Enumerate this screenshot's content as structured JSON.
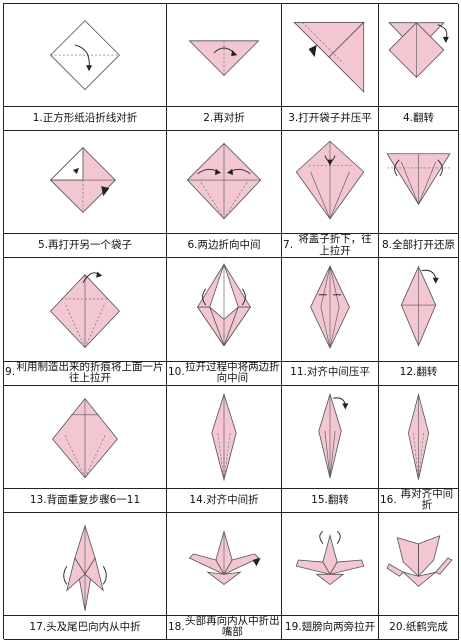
{
  "steps": [
    {
      "num": "1",
      "text": "正方形纸沿折线对折"
    },
    {
      "num": "2",
      "text": "再对折"
    },
    {
      "num": "3",
      "text": "打开袋子并压平"
    },
    {
      "num": "4",
      "text": "翻转"
    },
    {
      "num": "5",
      "text": "再打开另一个袋子"
    },
    {
      "num": "6",
      "text": "两边折向中间"
    },
    {
      "num": "7",
      "text": "将盖子折下，往上拉开"
    },
    {
      "num": "8",
      "text": "全部打开还原"
    },
    {
      "num": "9",
      "text": "利用制造出来的折痕将上面一片往上拉开"
    },
    {
      "num": "10",
      "text": "拉开过程中将两边折向中间"
    },
    {
      "num": "11",
      "text": "对齐中间压平"
    },
    {
      "num": "12",
      "text": "翻转"
    },
    {
      "num": "13",
      "text": "背面重复步骤6一11"
    },
    {
      "num": "14",
      "text": "对齐中间折"
    },
    {
      "num": "15",
      "text": "翻转"
    },
    {
      "num": "16",
      "text": "再对齐中间折"
    },
    {
      "num": "17",
      "text": "头及尾巴向内从中折"
    },
    {
      "num": "18",
      "text": "头部再向内从中折出嘴部"
    },
    {
      "num": "19",
      "text": "翅膀向两旁拉开"
    },
    {
      "num": "20",
      "text": "纸鹤完成"
    }
  ],
  "colors": {
    "paper": "#f2c7d2",
    "line": "#555555",
    "border": "#222222"
  }
}
